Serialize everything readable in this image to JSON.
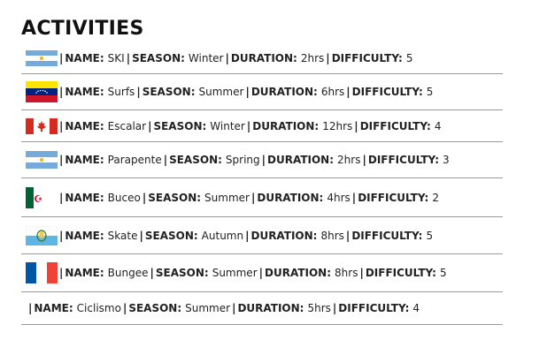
{
  "title": "ACTIVITIES",
  "labels": {
    "name": "NAME:",
    "season": "SEASON:",
    "duration": "DURATION:",
    "difficulty": "DIFFICULTY:"
  },
  "activities": [
    {
      "flag": "flag-argentina",
      "name": "SKI",
      "season": "Winter",
      "duration": "2hrs",
      "difficulty": "5"
    },
    {
      "flag": "flag-venezuela",
      "name": "Surfs",
      "season": "Summer",
      "duration": "6hrs",
      "difficulty": "5"
    },
    {
      "flag": "flag-canada",
      "name": "Escalar",
      "season": "Winter",
      "duration": "12hrs",
      "difficulty": "4"
    },
    {
      "flag": "flag-argentina",
      "name": "Parapente",
      "season": "Spring",
      "duration": "2hrs",
      "difficulty": "3"
    },
    {
      "flag": "flag-algeria",
      "name": "Buceo",
      "season": "Summer",
      "duration": "4hrs",
      "difficulty": "2"
    },
    {
      "flag": "flag-san-marino",
      "name": "Skate",
      "season": "Autumn",
      "duration": "8hrs",
      "difficulty": "5"
    },
    {
      "flag": "flag-france",
      "name": "Bungee",
      "season": "Summer",
      "duration": "8hrs",
      "difficulty": "5"
    },
    {
      "flag": "",
      "name": "Ciclismo",
      "season": "Summer",
      "duration": "5hrs",
      "difficulty": "4"
    }
  ],
  "colors": {
    "divider": "#999999",
    "argentina_blue": "#75AADB",
    "venezuela_yellow": "#FCE300",
    "venezuela_blue": "#00247D",
    "venezuela_red": "#CF142B",
    "canada_red": "#D52B1E",
    "algeria_green": "#006233",
    "algeria_red": "#D21034",
    "san_marino_blue": "#5EB6E4",
    "france_blue": "#0055A4",
    "france_red": "#EF4135"
  }
}
